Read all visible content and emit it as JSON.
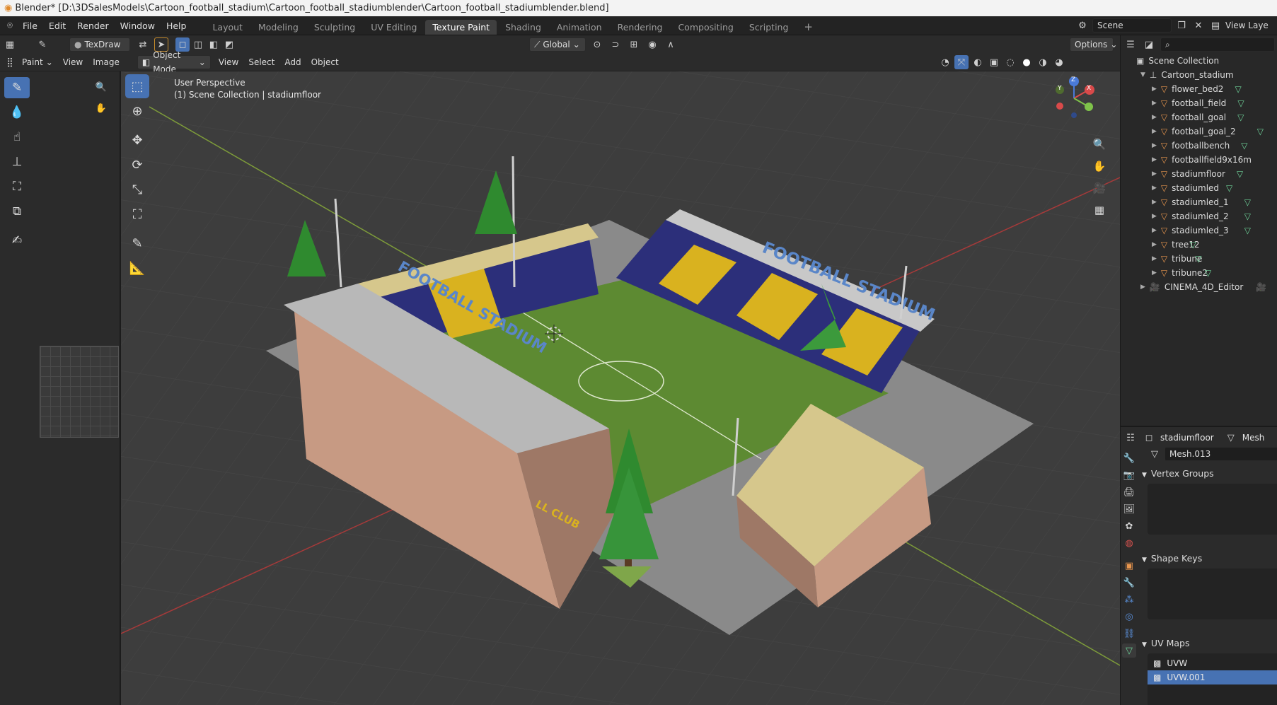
{
  "window_title": "Blender* [D:\\3DSalesModels\\Cartoon_football_stadium\\Cartoon_football_stadiumblender\\Cartoon_football_stadiumblender.blend]",
  "menu": [
    "File",
    "Edit",
    "Render",
    "Window",
    "Help"
  ],
  "workspaces": [
    "Layout",
    "Modeling",
    "Sculpting",
    "UV Editing",
    "Texture Paint",
    "Shading",
    "Animation",
    "Rendering",
    "Compositing",
    "Scripting"
  ],
  "active_workspace": "Texture Paint",
  "scene_name": "Scene",
  "view_layer": "View Laye",
  "left_header": {
    "brush": "TexDraw",
    "mode": "Paint",
    "view": "View",
    "image": "Image"
  },
  "viewport_header": {
    "mode": "Object Mode",
    "view": "View",
    "select": "Select",
    "add": "Add",
    "object": "Object",
    "orientation": "Global",
    "options": "Options"
  },
  "overlay_text": {
    "perspective": "User Perspective",
    "collection": "(1) Scene Collection | stadiumfloor"
  },
  "stadium_text": {
    "top_banner": "FOOTBALL STADIUM",
    "side_banner": "FOOTBALL STADIUM",
    "bottom_banner": "LL CLUB"
  },
  "gizmo": {
    "x": "X",
    "y": "Y",
    "z": "Z"
  },
  "outliner": {
    "root": "Scene Collection",
    "collection": "Cartoon_stadium",
    "objects": [
      "flower_bed2",
      "football_field",
      "football_goal",
      "football_goal_2",
      "footballbench",
      "footballfield9x16m",
      "stadiumfloor",
      "stadiumled",
      "stadiumled_1",
      "stadiumled_2",
      "stadiumled_3",
      "tree12",
      "tribune",
      "tribune2"
    ],
    "extra": "CINEMA_4D_Editor"
  },
  "properties": {
    "object": "stadiumfloor",
    "data_label": "Mesh",
    "mesh_name": "Mesh.013",
    "sections": [
      "Vertex Groups",
      "Shape Keys",
      "UV Maps"
    ],
    "uv_maps": [
      "UVW",
      "UVW.001"
    ]
  },
  "colors": {
    "accent": "#4772b3",
    "orange": "#e8964e",
    "green": "#6fd39a",
    "field": "#5d8a32",
    "seat_blue": "#2c2f7a",
    "seat_yellow": "#d9b21f",
    "banner_blue": "#5a86c8",
    "roof_tan": "#d6c78c",
    "roof_gray": "#b8b8b8",
    "wall": "#c79a83"
  }
}
